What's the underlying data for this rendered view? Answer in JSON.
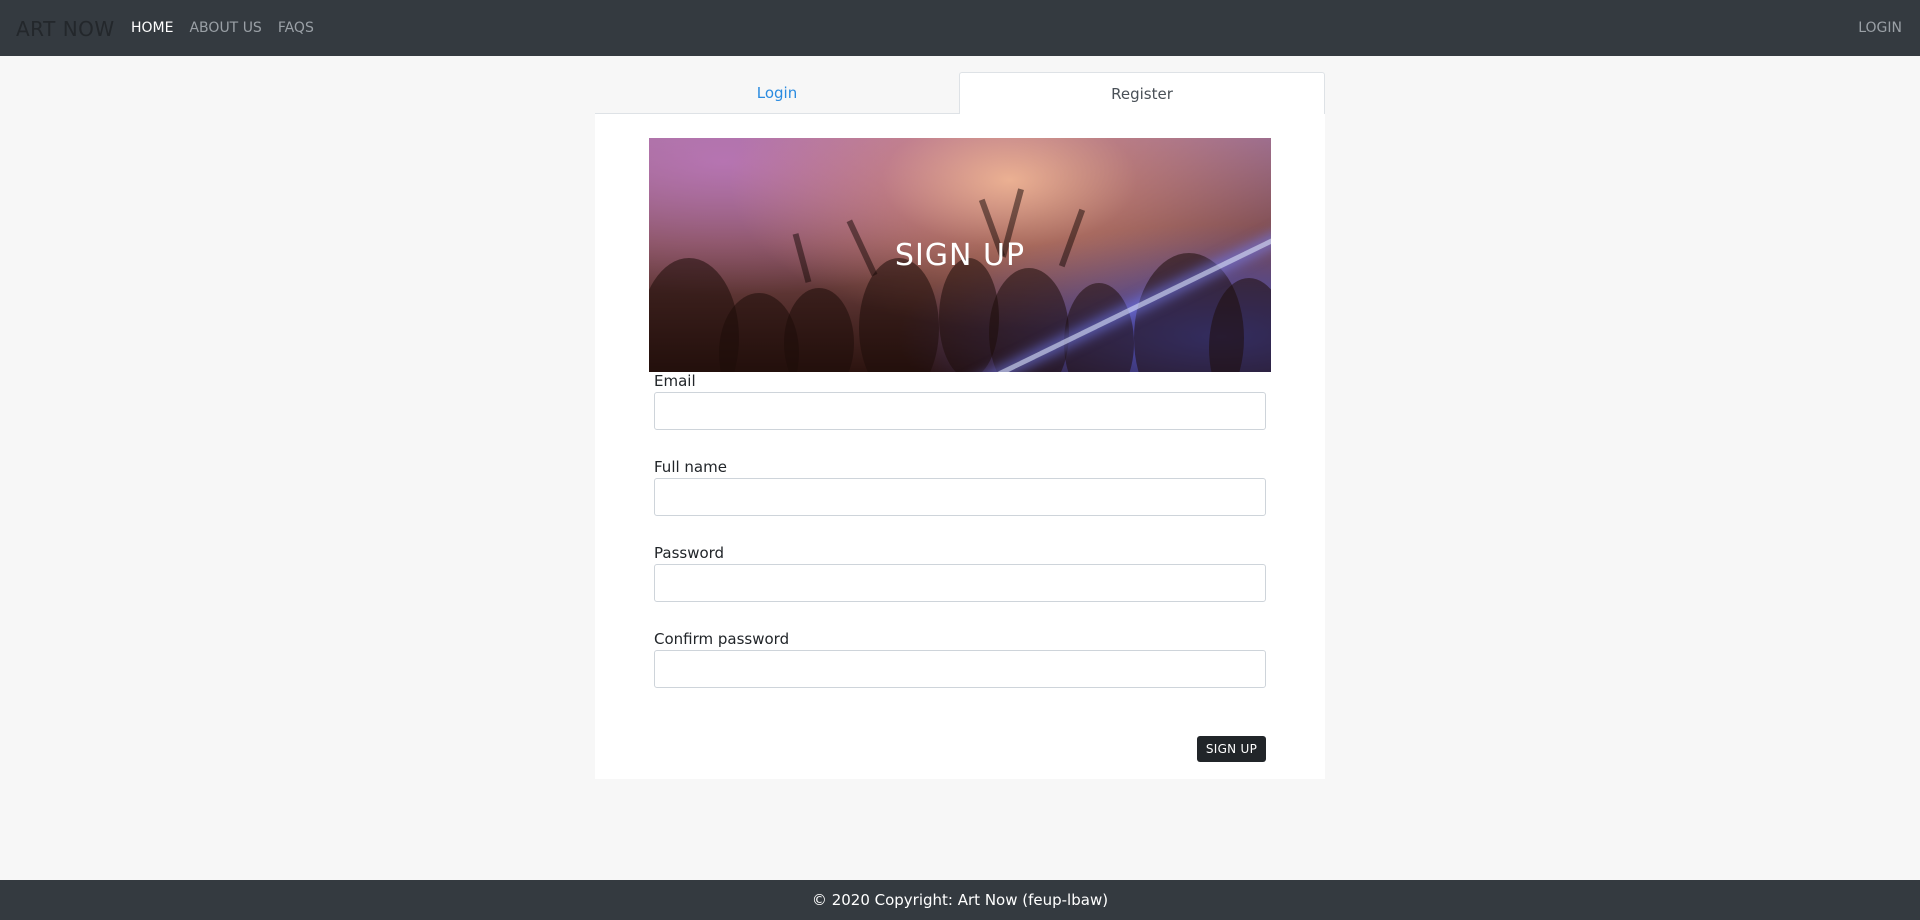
{
  "navbar": {
    "brand": "ART NOW",
    "links": [
      {
        "label": "HOME",
        "active": true
      },
      {
        "label": "ABOUT US",
        "active": false
      },
      {
        "label": "FAQS",
        "active": false
      }
    ],
    "login_label": "LOGIN"
  },
  "tabs": [
    {
      "label": "Login",
      "active": false
    },
    {
      "label": "Register",
      "active": true
    }
  ],
  "hero": {
    "title": "SIGN UP"
  },
  "form": {
    "fields": [
      {
        "label": "Email",
        "value": ""
      },
      {
        "label": "Full name",
        "value": ""
      },
      {
        "label": "Password",
        "value": ""
      },
      {
        "label": "Confirm password",
        "value": ""
      }
    ],
    "submit_label": "SIGN UP"
  },
  "footer": {
    "text": "© 2020 Copyright: Art Now (feup-lbaw)"
  },
  "colors": {
    "navbar_bg": "#343a40",
    "page_bg": "#f7f7f7",
    "link_accent": "#2a8be0",
    "button_bg": "#212529"
  }
}
